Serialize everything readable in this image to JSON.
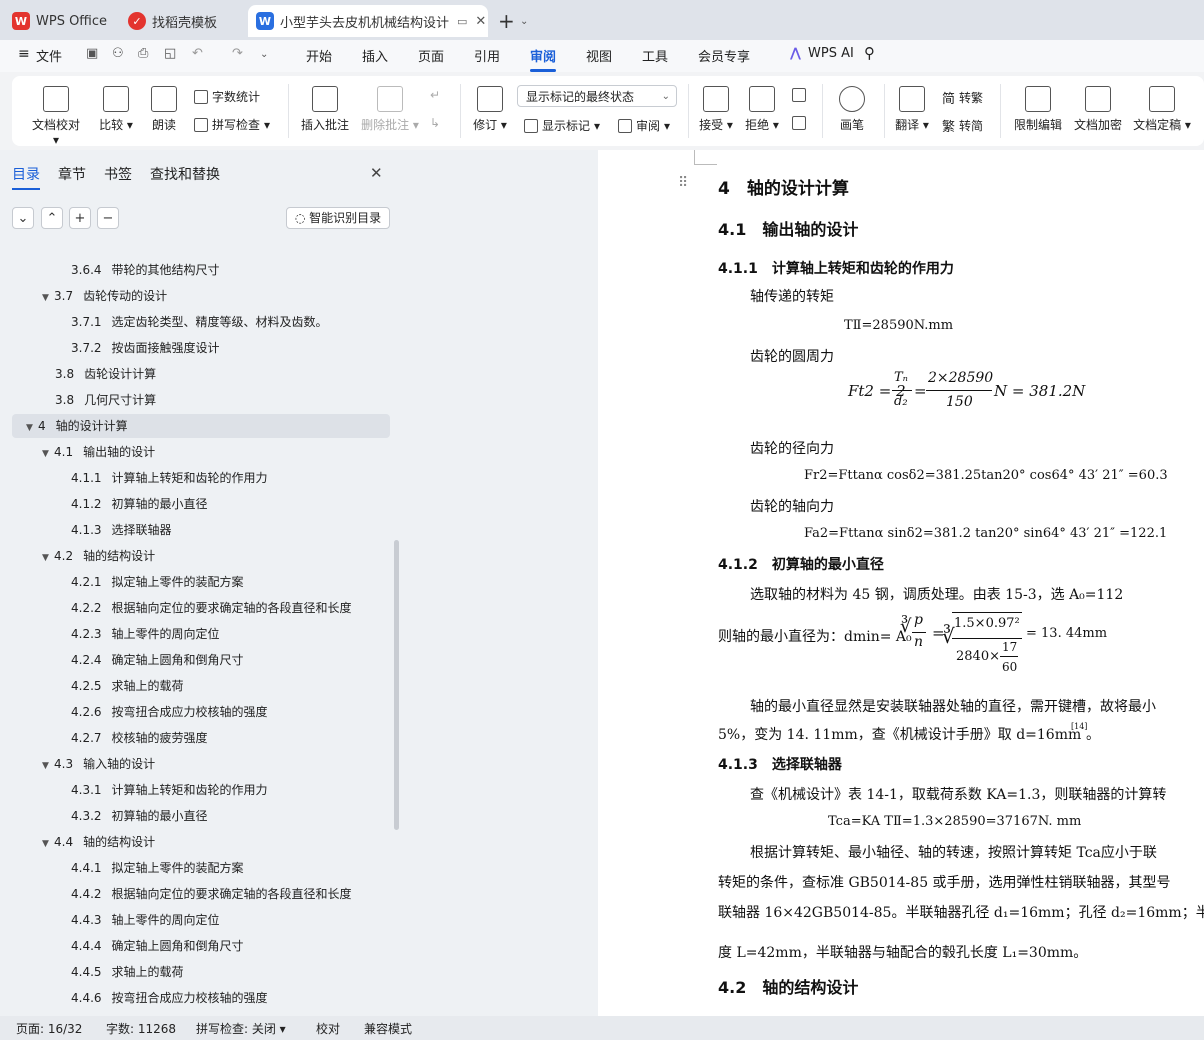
{
  "tabs": [
    {
      "label": "WPS Office"
    },
    {
      "label": "找稻壳模板"
    },
    {
      "label": "小型芋头去皮机机械结构设计"
    }
  ],
  "menubar": {
    "file": "文件",
    "items": [
      "开始",
      "插入",
      "页面",
      "引用",
      "审阅",
      "视图",
      "工具",
      "会员专享"
    ],
    "ai": "WPS AI"
  },
  "ribbon": {
    "doc_check": "文档校对",
    "compare": "比较",
    "read_aloud": "朗读",
    "word_count": "字数统计",
    "spell_check": "拼写检查",
    "insert_comment": "插入批注",
    "delete_comment": "删除批注",
    "revise": "修订",
    "markup_state": "显示标记的最终状态",
    "show_markup": "显示标记",
    "review": "审阅",
    "accept": "接受",
    "reject": "拒绝",
    "pen": "画笔",
    "translate": "翻译",
    "to_traditional": "转繁",
    "to_simplified": "转简",
    "restrict_edit": "限制编辑",
    "encrypt": "文档加密",
    "finalize": "文档定稿"
  },
  "sidebar": {
    "tabs": [
      "目录",
      "章节",
      "书签",
      "查找和替换"
    ],
    "smart_toc": "智能识别目录",
    "toc": [
      {
        "num": "3.6.4",
        "title": "带轮的其他结构尺寸",
        "level": 3
      },
      {
        "num": "3.7",
        "title": "齿轮传动的设计",
        "level": 2,
        "expanded": true
      },
      {
        "num": "3.7.1",
        "title": "选定齿轮类型、精度等级、材料及齿数。",
        "level": 3
      },
      {
        "num": "3.7.2",
        "title": "按齿面接触强度设计",
        "level": 3
      },
      {
        "num": "3.8",
        "title": "齿轮设计计算",
        "level": 2
      },
      {
        "num": "3.8",
        "title": "几何尺寸计算",
        "level": 2
      },
      {
        "num": "4",
        "title": "轴的设计计算",
        "level": 1,
        "expanded": true,
        "selected": true
      },
      {
        "num": "4.1",
        "title": "输出轴的设计",
        "level": 2,
        "expanded": true
      },
      {
        "num": "4.1.1",
        "title": "计算轴上转矩和齿轮的作用力",
        "level": 3
      },
      {
        "num": "4.1.2",
        "title": "初算轴的最小直径",
        "level": 3
      },
      {
        "num": "4.1.3",
        "title": "选择联轴器",
        "level": 3
      },
      {
        "num": "4.2",
        "title": "轴的结构设计",
        "level": 2,
        "expanded": true
      },
      {
        "num": "4.2.1",
        "title": "拟定轴上零件的装配方案",
        "level": 3
      },
      {
        "num": "4.2.2",
        "title": "根据轴向定位的要求确定轴的各段直径和长度",
        "level": 3
      },
      {
        "num": "4.2.3",
        "title": "轴上零件的周向定位",
        "level": 3
      },
      {
        "num": "4.2.4",
        "title": "确定轴上圆角和倒角尺寸",
        "level": 3
      },
      {
        "num": "4.2.5",
        "title": "求轴上的载荷",
        "level": 3
      },
      {
        "num": "4.2.6",
        "title": "按弯扭合成应力校核轴的强度",
        "level": 3
      },
      {
        "num": "4.2.7",
        "title": "校核轴的疲劳强度",
        "level": 3
      },
      {
        "num": "4.3",
        "title": "输入轴的设计",
        "level": 2,
        "expanded": true
      },
      {
        "num": "4.3.1",
        "title": "计算轴上转矩和齿轮的作用力",
        "level": 3
      },
      {
        "num": "4.3.2",
        "title": "初算轴的最小直径",
        "level": 3
      },
      {
        "num": "4.4",
        "title": "轴的结构设计",
        "level": 2,
        "expanded": true
      },
      {
        "num": "4.4.1",
        "title": "拟定轴上零件的装配方案",
        "level": 3
      },
      {
        "num": "4.4.2",
        "title": "根据轴向定位的要求确定轴的各段直径和长度",
        "level": 3
      },
      {
        "num": "4.4.3",
        "title": "轴上零件的周向定位",
        "level": 3
      },
      {
        "num": "4.4.4",
        "title": "确定轴上圆角和倒角尺寸",
        "level": 3
      },
      {
        "num": "4.4.5",
        "title": "求轴上的载荷",
        "level": 3
      },
      {
        "num": "4.4.6",
        "title": "按弯扭合成应力校核轴的强度",
        "level": 3
      }
    ]
  },
  "document": {
    "h1": "4　轴的设计计算",
    "h2_1": "4.1　输出轴的设计",
    "h3_1": "4.1.1　计算轴上转矩和齿轮的作用力",
    "p_torque": "轴传递的转矩",
    "f_torque": "TⅡ=28590N.mm",
    "p_circ": "齿轮的圆周力",
    "f_circ_lhs": "Ft2 = 2",
    "f_circ_t": "Tₙ",
    "f_circ_d": "d₂",
    "f_circ_num": "2×28590",
    "f_circ_den": "150",
    "f_circ_rhs": "N = 381.2N",
    "p_radial": "齿轮的径向力",
    "f_radial": "Fr2=Fttanα cosδ2=381.25tan20° cos64° 43′ 21″ =60.3",
    "p_axial": "齿轮的轴向力",
    "f_axial": "Fa2=Fttanα sinδ2=381.2 tan20° sin64° 43′ 21″ =122.1",
    "h3_2": "4.1.2　初算轴的最小直径",
    "p_material": "选取轴的材料为 45 钢，调质处理。由表 15-3，选 A₀=112",
    "p_mindia": "则轴的最小直径为：dmin= A₀",
    "f_mindia_p": "p",
    "f_mindia_n": "n",
    "f_mindia_num": "1.5×0.97²",
    "f_mindia_den": "2840×",
    "f_mindia_frac_num": "17",
    "f_mindia_frac_den": "60",
    "f_mindia_res": "= 13. 44mm",
    "p_explain1": "轴的最小直径显然是安装联轴器处轴的直径，需开键槽，故将最小",
    "p_explain2": "5%，变为 14. 11mm，查《机械设计手册》取 d=16mm",
    "p_ref": "[14]",
    "h3_3": "4.1.3　选择联轴器",
    "p_coupling": "查《机械设计》表 14-1，取载荷系数 KA=1.3，则联轴器的计算转",
    "f_tca": "Tca=KA TⅡ=1.3×28590=37167N. mm",
    "p_choose1": "根据计算转矩、最小轴径、轴的转速，按照计算转矩 Tca应小于联",
    "p_choose2": "转矩的条件，查标准 GB5014-85 或手册，选用弹性柱销联轴器，其型号",
    "p_choose3": "联轴器 16×42GB5014-85。半联轴器孔径 d₁=16mm；孔径 d₂=16mm；半",
    "p_choose4": "度 L=42mm，半联轴器与轴配合的毂孔长度 L₁=30mm。",
    "h2_2": "4.2　轴的结构设计"
  },
  "status": {
    "page": "页面: 16/32",
    "words": "字数: 11268",
    "spell": "拼写检查: 关闭",
    "proof": "校对",
    "compat": "兼容模式"
  },
  "colors": {
    "accent": "#1a5fd8",
    "wps_red": "#e3342f"
  }
}
